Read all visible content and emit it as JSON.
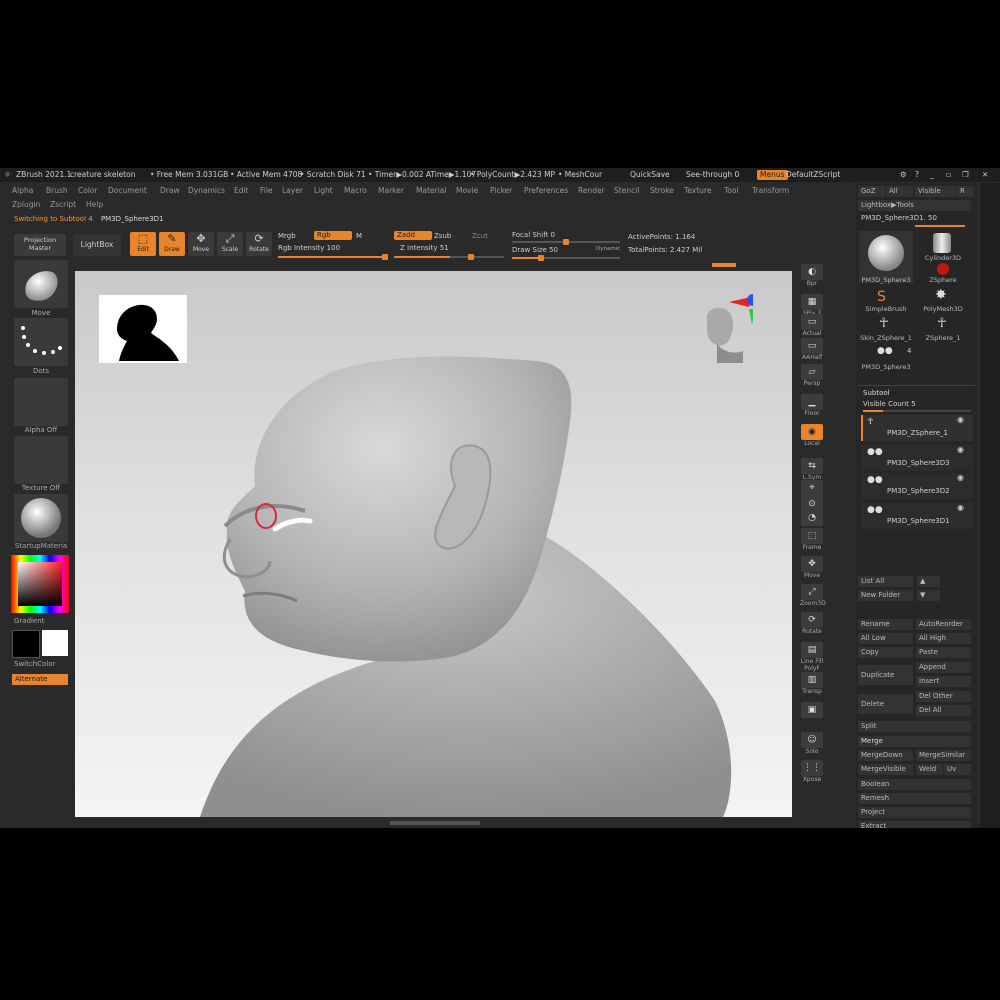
{
  "titlebar": {
    "app": "ZBrush 2021.1",
    "document": "creature skeleton",
    "free_mem": "• Free Mem 3.031GB",
    "active_mem": "• Active Mem 4708",
    "scratch": "• Scratch Disk 71",
    "timer": "• Timer▶0.002 ATime▶1.107",
    "polycount": "• PolyCount▶2.423 MP",
    "meshcount": "• MeshCour",
    "quicksave": "QuickSave",
    "see_through": "See-through  0",
    "menus": "Menus",
    "script": "DefaultZScript"
  },
  "menu": [
    "Alpha",
    "Brush",
    "Color",
    "Document",
    "Draw",
    "Dynamics",
    "Edit",
    "File",
    "Layer",
    "Light",
    "Macro",
    "Marker",
    "Material",
    "Movie",
    "Picker",
    "Preferences",
    "Render",
    "Stencil",
    "Stroke",
    "Texture",
    "Tool",
    "Transform"
  ],
  "menu2": [
    "Zplugin",
    "Zscript",
    "Help"
  ],
  "status": {
    "left": "Switching to Subtool 4",
    "right": "PM3D_Sphere3D1"
  },
  "toolbar": {
    "projection_master": "Projection Master",
    "lightbox": "LightBox",
    "edit": "Edit",
    "draw": "Draw",
    "move": "Move",
    "scale": "Scale",
    "rotate": "Rotate",
    "mrgb": "Mrgb",
    "rgb": "Rgb",
    "m": "M",
    "rgb_intensity": "Rgb Intensity 100",
    "zadd": "Zadd",
    "zsub": "Zsub",
    "zcut": "Zcut",
    "z_intensity": "Z Intensity 51",
    "focal_shift": "Focal Shift 0",
    "draw_size": "Draw Size 50",
    "dynamic": "Dynamic",
    "active_points": "ActivePoints: 1.164",
    "total_points": "TotalPoints: 2.427 Mil"
  },
  "left_panel": {
    "move": "Move",
    "dots": "Dots",
    "alpha_off": "Alpha Off",
    "texture_off": "Texture Off",
    "material": "StartupMateria",
    "gradient": "Gradient",
    "switch_color": "SwitchColor",
    "alternate": "Alternate"
  },
  "shelf": [
    "Bpr",
    "SPix 3",
    "Actual",
    "AAHalf",
    "Persp",
    "Floor",
    "Local",
    "L.Sym",
    "Qxyz",
    "",
    "",
    "Frame",
    "Move",
    "Zoom3D",
    "Rotate",
    "Line Fill PolyF",
    "Transp",
    "",
    "Solo",
    "Xpose"
  ],
  "rpanel": {
    "goz": "GoZ",
    "all": "All",
    "visible": "Visible",
    "r": "R",
    "lightbox_tools": "Lightbox▶Tools",
    "current_tool": "PM3D_Sphere3D1. 50",
    "tools": [
      "PM3D_Sphere3",
      "Cylinder3D",
      "SimpleBrush",
      "PolyMesh3D",
      "Skin_ZSphere_1",
      "ZSphere_1",
      "PM3D_Sphere3"
    ],
    "zsphere": "ZSphere",
    "tool_count": "4",
    "subtool_title": "Subtool",
    "visible_count": "Visible Count 5",
    "subtools": [
      "PM3D_ZSphere_1",
      "PM3D_Sphere3D3",
      "PM3D_Sphere3D2",
      "PM3D_Sphere3D1"
    ],
    "list_all": "List All",
    "new_folder": "New Folder",
    "rename": "Rename",
    "auto_reorder": "AutoReorder",
    "all_low": "All Low",
    "all_high": "All High",
    "copy": "Copy",
    "paste": "Paste",
    "duplicate": "Duplicate",
    "append": "Append",
    "insert": "Insert",
    "delete": "Delete",
    "del_other": "Del Other",
    "del_all": "Del All",
    "split": "Split",
    "merge": "Merge",
    "merge_down": "MergeDown",
    "merge_similar": "MergeSimilar",
    "merge_visible": "MergeVisible",
    "weld": "Weld",
    "uv": "Uv",
    "boolean": "Boolean",
    "remesh": "Remesh",
    "project": "Project",
    "extract": "Extract"
  },
  "colors": {
    "accent": "#e8852c",
    "panel": "#2a2a2a",
    "canvas_top": "#c9c9c9",
    "canvas_bottom": "#f4f4f4"
  }
}
